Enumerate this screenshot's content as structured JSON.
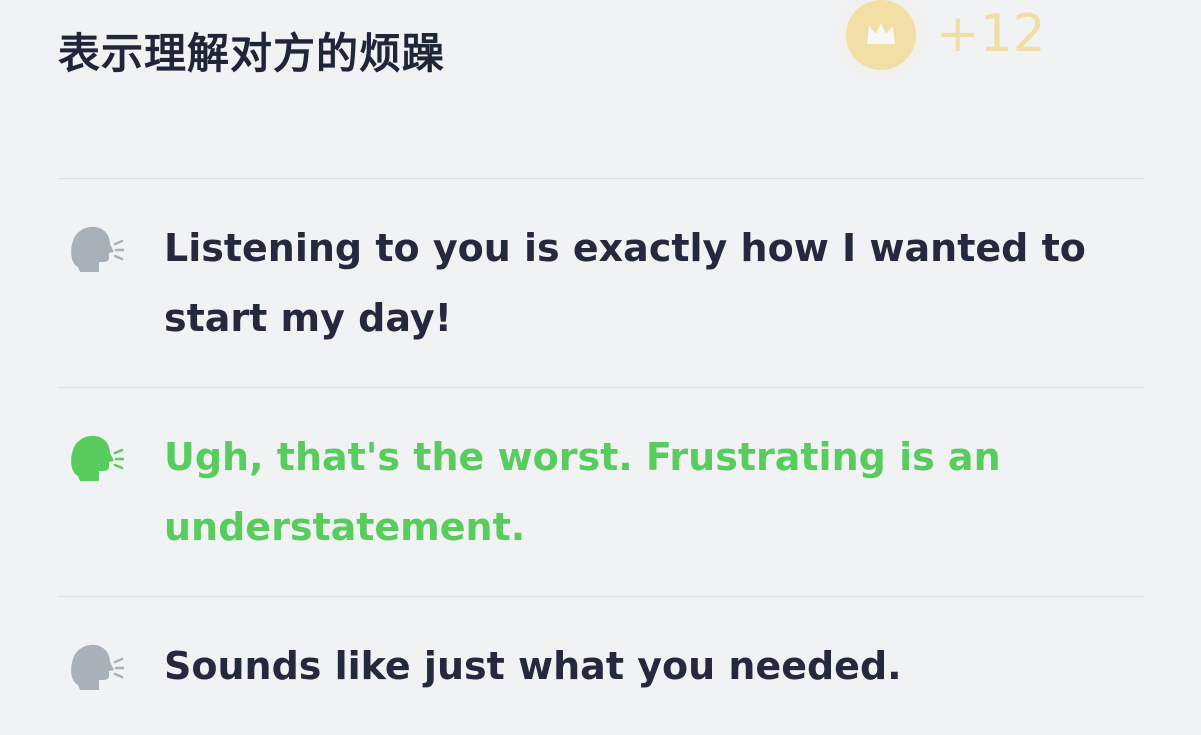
{
  "header": {
    "title": "表示理解对方的烦躁",
    "reward_text": "+12"
  },
  "options": [
    {
      "text": "Listening to you is exactly how I wanted to start my day!",
      "selected": false
    },
    {
      "text": "Ugh, that's the worst. Frustrating is an understatement.",
      "selected": true
    },
    {
      "text": "Sounds like just what you needed.",
      "selected": false
    }
  ],
  "icons": {
    "reward": "crown-coin-icon",
    "option": "speaking-head-icon"
  },
  "colors": {
    "background": "#f1f2f4",
    "text": "#24293d",
    "selected": "#58cc5d",
    "icon_inactive": "#aab0b8",
    "coin": "#f3c94a"
  }
}
